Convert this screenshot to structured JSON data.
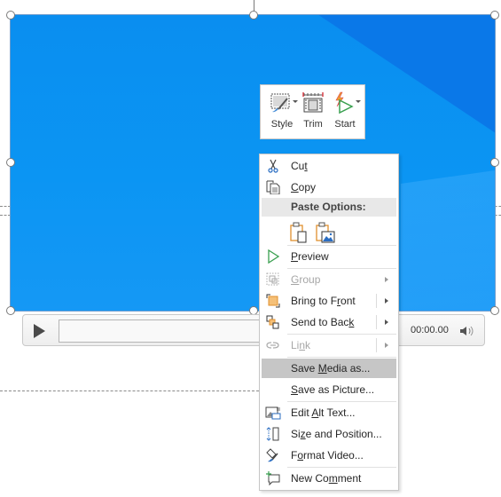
{
  "video": {
    "accent_color": "#0b90f1"
  },
  "player": {
    "time": "00:00.00",
    "progress_percent": 0,
    "play_icon": "play-icon",
    "volume_icon": "speaker-icon"
  },
  "mini_toolbar": {
    "buttons": [
      {
        "label": "Style",
        "icon": "video-style-icon",
        "has_dropdown": true
      },
      {
        "label": "Trim",
        "icon": "trim-video-icon",
        "has_dropdown": false
      },
      {
        "label": "Start",
        "icon": "start-icon",
        "has_dropdown": true
      }
    ]
  },
  "context_menu": {
    "items": [
      {
        "pre": "Cu",
        "key": "t",
        "post": "",
        "icon": "scissors-icon",
        "enabled": true
      },
      {
        "pre": "",
        "key": "C",
        "post": "opy",
        "icon": "copy-icon",
        "enabled": true
      },
      {
        "label": "Paste Options:",
        "icon": "paste-icon",
        "type": "header"
      },
      {
        "pre": "",
        "key": "P",
        "post": "review",
        "icon": "preview-play-icon",
        "enabled": true
      },
      {
        "pre": "",
        "key": "G",
        "post": "roup",
        "icon": "group-icon",
        "enabled": false,
        "submenu": true
      },
      {
        "pre": "Bring to F",
        "key": "r",
        "post": "ont",
        "icon": "bring-to-front-icon",
        "enabled": true,
        "submenu": true
      },
      {
        "pre": "Send to Bac",
        "key": "k",
        "post": "",
        "icon": "send-to-back-icon",
        "enabled": true,
        "submenu": true
      },
      {
        "pre": "Li",
        "key": "n",
        "post": "k",
        "icon": "link-icon",
        "enabled": false,
        "submenu": true
      },
      {
        "pre": "Save ",
        "key": "M",
        "post": "edia as...",
        "icon": "",
        "enabled": true,
        "highlighted": true
      },
      {
        "pre": "",
        "key": "S",
        "post": "ave as Picture...",
        "icon": "",
        "enabled": true
      },
      {
        "pre": "Edit ",
        "key": "A",
        "post": "lt Text...",
        "icon": "alt-text-icon",
        "enabled": true
      },
      {
        "pre": "Si",
        "key": "z",
        "post": "e and Position...",
        "icon": "size-position-icon",
        "enabled": true
      },
      {
        "pre": "F",
        "key": "o",
        "post": "rmat Video...",
        "icon": "format-video-icon",
        "enabled": true
      },
      {
        "pre": "New Co",
        "key": "m",
        "post": "ment",
        "icon": "new-comment-icon",
        "enabled": true
      }
    ],
    "paste_options": [
      {
        "icon": "paste-keep-source-icon"
      },
      {
        "icon": "paste-picture-icon"
      }
    ]
  }
}
